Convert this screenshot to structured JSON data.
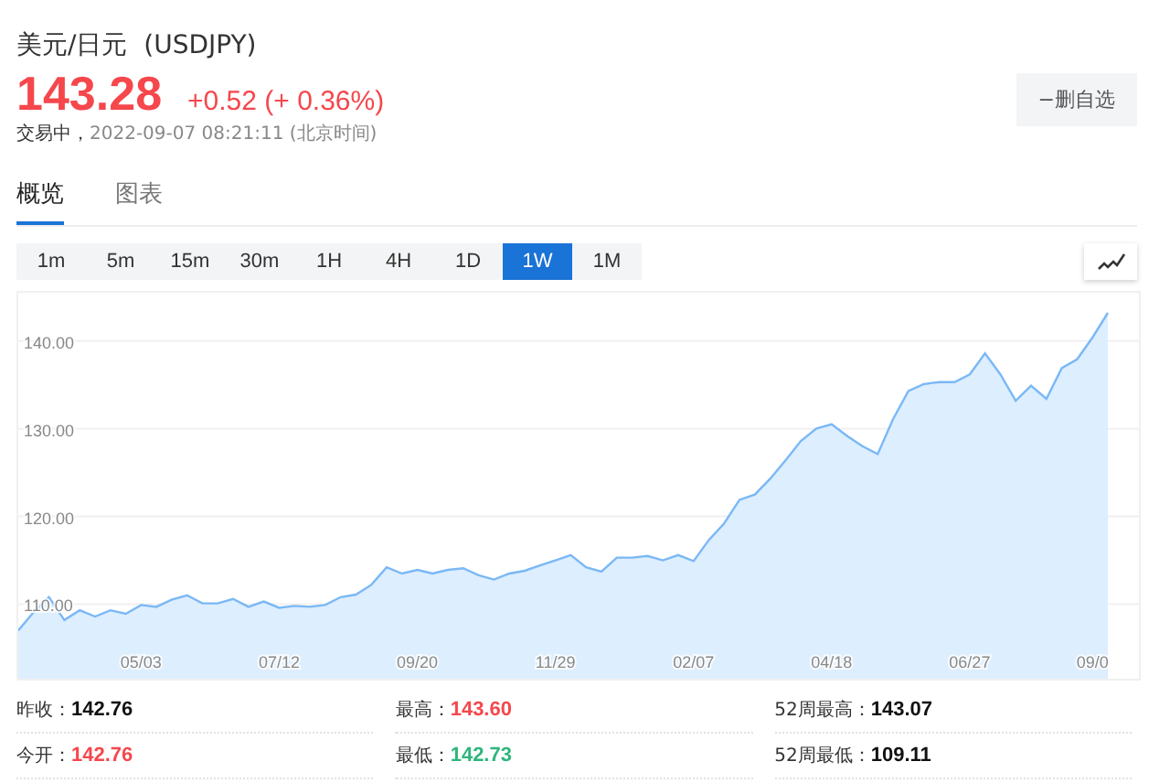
{
  "header": {
    "title": "美元/日元  (USDJPY)",
    "price": "143.28",
    "change": "+0.52 (+ 0.36%)",
    "status": "交易中，",
    "time": "2022-09-07 08:21:11 (北京时间)",
    "watch_button": "−删自选"
  },
  "tabs": [
    {
      "label": "概览",
      "selected": true
    },
    {
      "label": "图表",
      "selected": false
    }
  ],
  "periods": [
    {
      "label": "1m",
      "selected": false
    },
    {
      "label": "5m",
      "selected": false
    },
    {
      "label": "15m",
      "selected": false
    },
    {
      "label": "30m",
      "selected": false
    },
    {
      "label": "1H",
      "selected": false
    },
    {
      "label": "4H",
      "selected": false
    },
    {
      "label": "1D",
      "selected": false
    },
    {
      "label": "1W",
      "selected": true
    },
    {
      "label": "1M",
      "selected": false
    }
  ],
  "chart_data": {
    "type": "area",
    "grid": true,
    "ylim": [
      101.5,
      145.5
    ],
    "categories": [
      null,
      null,
      null,
      null,
      null,
      null,
      null,
      null,
      "05/03",
      null,
      null,
      null,
      null,
      null,
      null,
      null,
      null,
      "07/12",
      null,
      null,
      null,
      null,
      null,
      null,
      null,
      null,
      "09/20",
      null,
      null,
      null,
      null,
      null,
      null,
      null,
      null,
      "11/29",
      null,
      null,
      null,
      null,
      null,
      null,
      null,
      null,
      "02/07",
      null,
      null,
      null,
      null,
      null,
      null,
      null,
      null,
      "04/18",
      null,
      null,
      null,
      null,
      null,
      null,
      null,
      null,
      "06/27",
      null,
      null,
      null,
      null,
      null,
      null,
      null,
      "09/0",
      null
    ],
    "series": [
      {
        "color": "#7ab8f5",
        "values": [
          107.0,
          109.1,
          110.8,
          108.2,
          109.3,
          108.6,
          109.3,
          108.9,
          109.9,
          109.7,
          110.5,
          111.0,
          110.1,
          110.1,
          110.6,
          109.7,
          110.3,
          109.6,
          109.8,
          109.7,
          109.9,
          110.8,
          111.1,
          112.2,
          114.2,
          113.5,
          113.9,
          113.5,
          113.9,
          114.1,
          113.3,
          112.8,
          113.5,
          113.8,
          114.4,
          115.0,
          115.6,
          114.2,
          113.7,
          115.3,
          115.3,
          115.5,
          115.0,
          115.6,
          114.9,
          117.3,
          119.2,
          121.9,
          122.5,
          124.3,
          126.4,
          128.6,
          130.0,
          130.5,
          129.2,
          128.0,
          127.1,
          131.1,
          134.3,
          135.1,
          135.3,
          135.3,
          136.2,
          138.6,
          136.2,
          133.2,
          134.9,
          133.4,
          136.9,
          137.9,
          140.4,
          143.2
        ]
      }
    ],
    "yticks": [
      {
        "value": 110,
        "label": "110.00"
      },
      {
        "value": 120,
        "label": "120.00"
      },
      {
        "value": 130,
        "label": "130.00"
      },
      {
        "value": 140,
        "label": "140.00"
      }
    ]
  },
  "stats": [
    {
      "label": "昨收：",
      "value": "142.76",
      "color": "#111111"
    },
    {
      "label": "最高：",
      "value": "143.60",
      "color": "#f5474c"
    },
    {
      "label": "52周最高：",
      "value": "143.07",
      "color": "#111111"
    },
    {
      "label": "今开：",
      "value": "142.76",
      "color": "#f5474c"
    },
    {
      "label": "最低：",
      "value": "142.73",
      "color": "#2eb67d"
    },
    {
      "label": "52周最低：",
      "value": "109.11",
      "color": "#111111"
    }
  ]
}
